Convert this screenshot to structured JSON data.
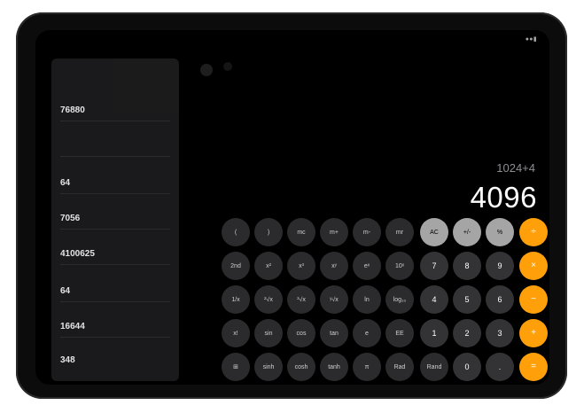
{
  "history": [
    {
      "expression": "",
      "result": "76880"
    },
    {
      "expression": "",
      "result": ""
    },
    {
      "expression": "",
      "result": "64"
    },
    {
      "expression": "",
      "result": "7056"
    },
    {
      "expression": "",
      "result": "4100625"
    },
    {
      "expression": "",
      "result": "64"
    },
    {
      "expression": "",
      "result": "16644"
    },
    {
      "expression": "",
      "result": "348"
    }
  ],
  "display": {
    "expression": "1024+4",
    "result": "4096"
  },
  "keys": [
    [
      "(",
      ")",
      "mc",
      "m+",
      "m-",
      "mr",
      "AC",
      "+/-",
      "%",
      "÷"
    ],
    [
      "2nd",
      "x²",
      "x³",
      "xʸ",
      "eˣ",
      "10ˣ",
      "7",
      "8",
      "9",
      "×"
    ],
    [
      "1/x",
      "²√x",
      "³√x",
      "ʸ√x",
      "ln",
      "log₁₀",
      "4",
      "5",
      "6",
      "−"
    ],
    [
      "x!",
      "sin",
      "cos",
      "tan",
      "e",
      "EE",
      "1",
      "2",
      "3",
      "+"
    ],
    [
      "⊞",
      "sinh",
      "cosh",
      "tanh",
      "π",
      "Rad",
      "Rand",
      "0",
      ".",
      "="
    ]
  ]
}
